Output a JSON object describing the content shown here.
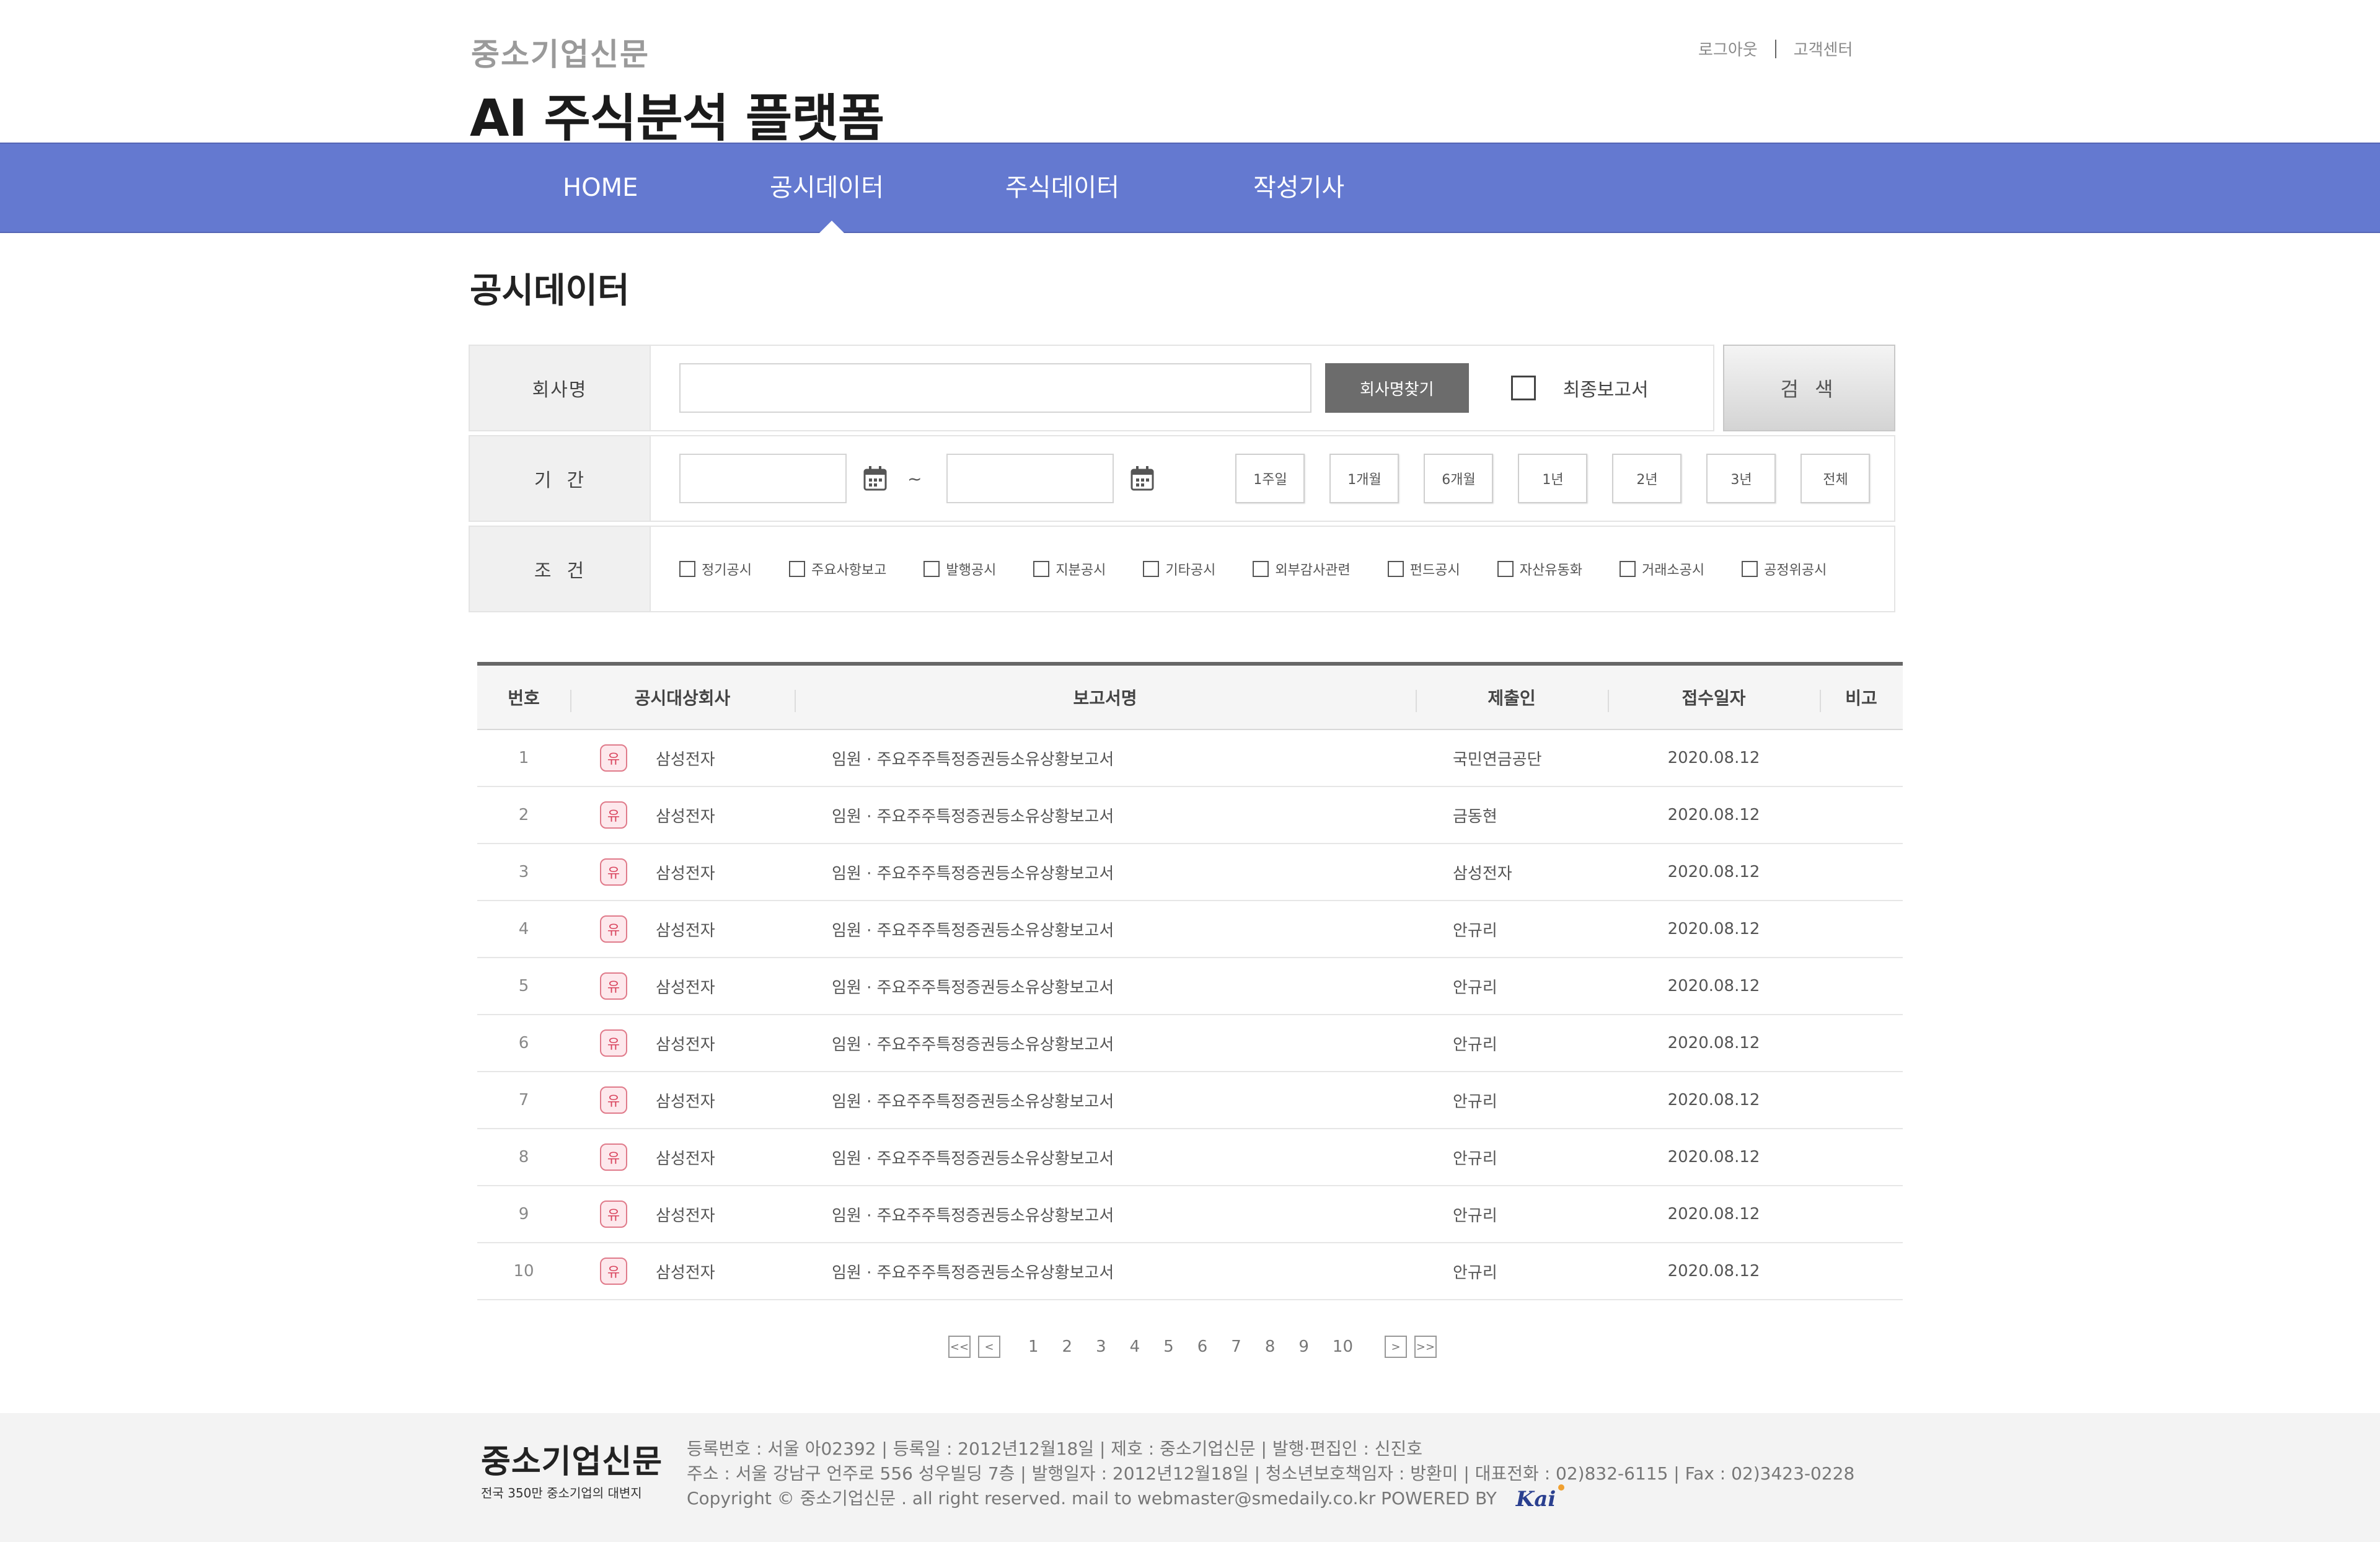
{
  "header": {
    "brand": "중소기업신문",
    "title": "AI 주식분석 플랫폼",
    "links": [
      "로그아웃",
      "고객센터"
    ]
  },
  "nav": {
    "items": [
      "HOME",
      "공시데이터",
      "주식데이터",
      "작성기사"
    ],
    "active": "공시데이터"
  },
  "page": {
    "title": "공시데이터"
  },
  "search": {
    "company_label": "회사명",
    "company_value": "",
    "find_button": "회사명찾기",
    "final_report_label": "최종보고서",
    "final_report_checked": false,
    "search_button": "검 색",
    "period_label": "기  간",
    "date_from": "",
    "date_to": "",
    "tilde": "~",
    "periods": [
      "1주일",
      "1개월",
      "6개월",
      "1년",
      "2년",
      "3년",
      "전체"
    ],
    "condition_label": "조  건",
    "conditions": [
      "정기공시",
      "주요사항보고",
      "발행공시",
      "지분공시",
      "기타공시",
      "외부감사관련",
      "펀드공시",
      "자산유동화",
      "거래소공시",
      "공정위공시"
    ]
  },
  "table": {
    "headers": [
      "번호",
      "공시대상회사",
      "보고서명",
      "제출인",
      "접수일자",
      "비고"
    ],
    "badge": "유",
    "rows": [
      {
        "no": "1",
        "company": "삼성전자",
        "report": "임원 · 주요주주특정증권등소유상황보고서",
        "submitter": "국민연금공단",
        "date": "2020.08.12",
        "note": ""
      },
      {
        "no": "2",
        "company": "삼성전자",
        "report": "임원 · 주요주주특정증권등소유상황보고서",
        "submitter": "금동현",
        "date": "2020.08.12",
        "note": ""
      },
      {
        "no": "3",
        "company": "삼성전자",
        "report": "임원 · 주요주주특정증권등소유상황보고서",
        "submitter": "삼성전자",
        "date": "2020.08.12",
        "note": ""
      },
      {
        "no": "4",
        "company": "삼성전자",
        "report": "임원 · 주요주주특정증권등소유상황보고서",
        "submitter": "안규리",
        "date": "2020.08.12",
        "note": ""
      },
      {
        "no": "5",
        "company": "삼성전자",
        "report": "임원 · 주요주주특정증권등소유상황보고서",
        "submitter": "안규리",
        "date": "2020.08.12",
        "note": ""
      },
      {
        "no": "6",
        "company": "삼성전자",
        "report": "임원 · 주요주주특정증권등소유상황보고서",
        "submitter": "안규리",
        "date": "2020.08.12",
        "note": ""
      },
      {
        "no": "7",
        "company": "삼성전자",
        "report": "임원 · 주요주주특정증권등소유상황보고서",
        "submitter": "안규리",
        "date": "2020.08.12",
        "note": ""
      },
      {
        "no": "8",
        "company": "삼성전자",
        "report": "임원 · 주요주주특정증권등소유상황보고서",
        "submitter": "안규리",
        "date": "2020.08.12",
        "note": ""
      },
      {
        "no": "9",
        "company": "삼성전자",
        "report": "임원 · 주요주주특정증권등소유상황보고서",
        "submitter": "안규리",
        "date": "2020.08.12",
        "note": ""
      },
      {
        "no": "10",
        "company": "삼성전자",
        "report": "임원 · 주요주주특정증권등소유상황보고서",
        "submitter": "안규리",
        "date": "2020.08.12",
        "note": ""
      }
    ]
  },
  "pagination": {
    "first": "<<",
    "prev": "<",
    "next": ">",
    "last": ">>",
    "pages": [
      "1",
      "2",
      "3",
      "4",
      "5",
      "6",
      "7",
      "8",
      "9",
      "10"
    ]
  },
  "footer": {
    "logo": "중소기업신문",
    "logo_sub": "전국 350만 중소기업의 대변지",
    "line1": "등록번호 : 서울 아02392 | 등록일 : 2012년12월18일 | 제호 : 중소기업신문 | 발행·편집인 : 신진호",
    "line2": "주소 : 서울 강남구 언주로 556 성우빌딩 7층 | 발행일자 : 2012년12월18일 | 청소년보호책임자 : 방환미 | 대표전화 : 02)832-6115 | Fax : 02)3423-0228",
    "line3": "Copyright © 중소기업신문 . all right reserved. mail to webmaster@smedaily.co.kr  POWERED BY",
    "powered_logo": "Kai"
  },
  "colors": {
    "nav_bg": "#6479d0",
    "badge": "#d9455e",
    "dark_button": "#6c6c6c"
  }
}
